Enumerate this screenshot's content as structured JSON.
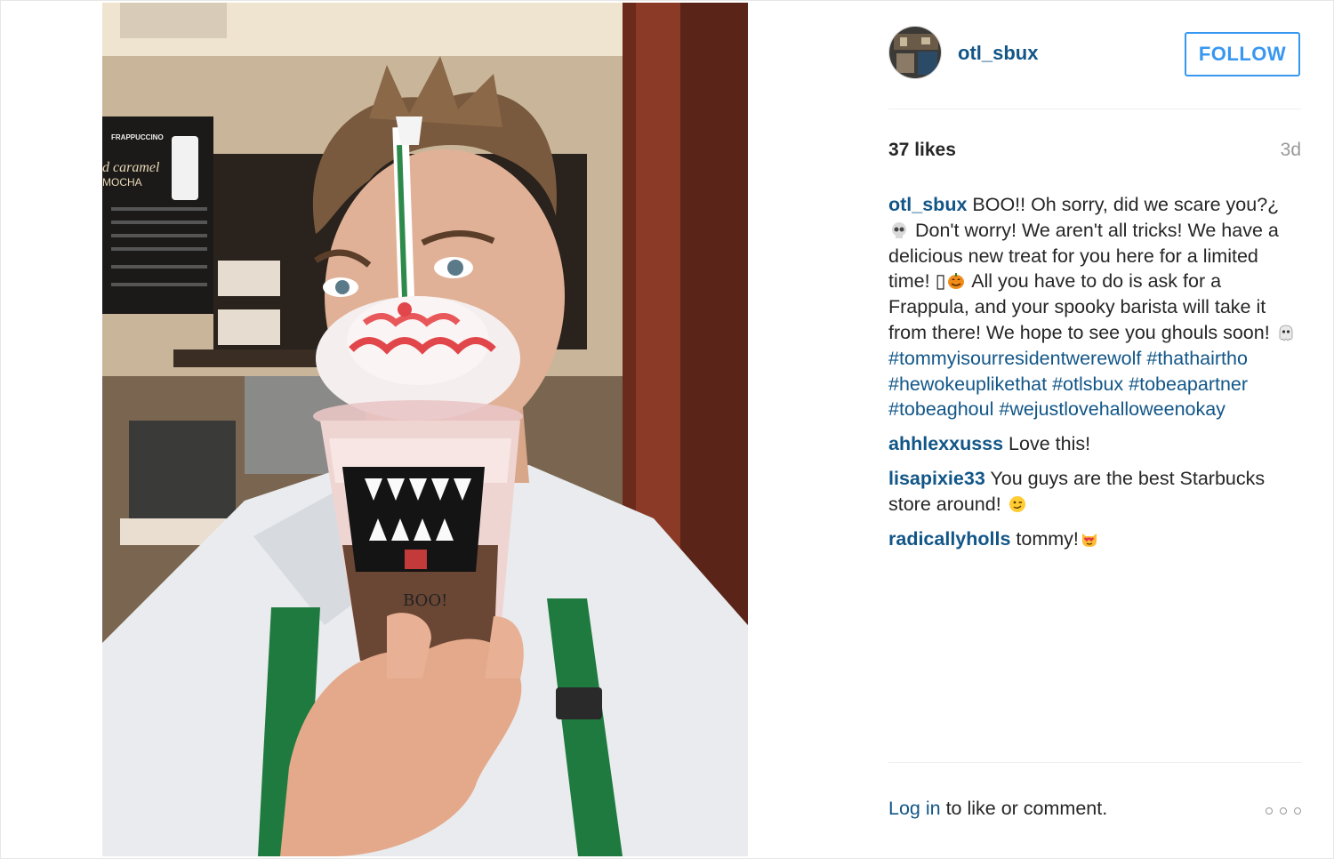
{
  "post": {
    "username": "otl_sbux",
    "follow_label": "FOLLOW",
    "likes": "37 likes",
    "age": "3d",
    "caption": {
      "user": "otl_sbux",
      "text_1": " BOO!! Oh sorry, did we scare you?¿ ",
      "text_2": "  Don't worry! We aren't all tricks! We have a delicious new treat for you here for a limited time! ▯",
      "text_3": "  All you have to do is ask for a Frappula, and your spooky barista will take it from there! We hope to see you ghouls soon! ",
      "hashtags": [
        "#tommyisourresidentwerewolf",
        "#thathairtho",
        "#hewokeuplikethat",
        "#otlsbux",
        "#tobeapartner",
        "#tobeaghoul",
        "#wejustlovehalloweenokay"
      ]
    },
    "comments": [
      {
        "user": "ahhlexxusss",
        "text": " Love this!"
      },
      {
        "user": "lisapixie33",
        "text": " You guys are the best Starbucks store around! "
      },
      {
        "user": "radicallyholls",
        "text": " tommy!"
      }
    ],
    "login_link": "Log in",
    "login_text": " to like or comment."
  },
  "photo": {
    "menu_board": {
      "title": "FRAPPUCCINO",
      "line_1": "d caramel",
      "line_2": "MOCHA"
    },
    "cup_text": "BOO!"
  },
  "icons": [
    "skull-emoji",
    "pumpkin-emoji",
    "ghost-emoji",
    "wink-emoji",
    "heart-eyes-cat-emoji",
    "more-options-icon"
  ],
  "colors": {
    "link": "#125688",
    "follow": "#3897f0",
    "starbucks_green": "#1e7a3e"
  }
}
